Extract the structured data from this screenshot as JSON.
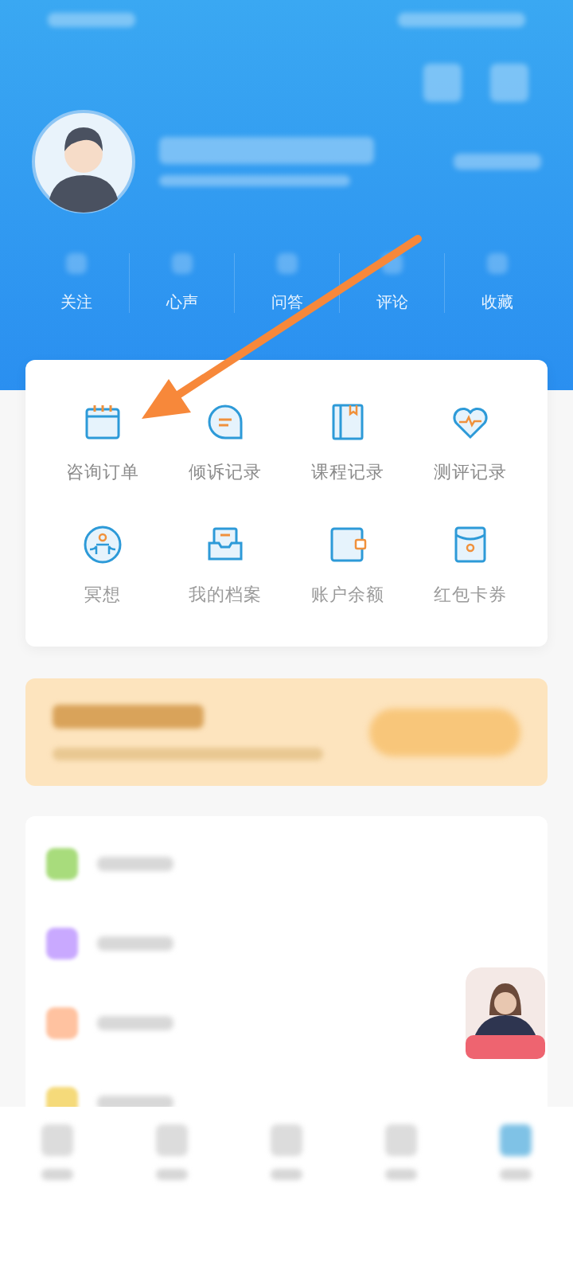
{
  "stats": [
    {
      "label": "关注"
    },
    {
      "label": "心声"
    },
    {
      "label": "问答"
    },
    {
      "label": "评论"
    },
    {
      "label": "收藏"
    }
  ],
  "services": [
    {
      "label": "咨询订单",
      "kind": "calendar"
    },
    {
      "label": "倾诉记录",
      "kind": "bubble"
    },
    {
      "label": "课程记录",
      "kind": "book"
    },
    {
      "label": "测评记录",
      "kind": "heart"
    },
    {
      "label": "冥想",
      "kind": "meditation"
    },
    {
      "label": "我的档案",
      "kind": "tray"
    },
    {
      "label": "账户余额",
      "kind": "wallet"
    },
    {
      "label": "红包卡券",
      "kind": "envelope"
    }
  ],
  "menu": [
    {
      "color": "#a8dc7c"
    },
    {
      "color": "#c9a9ff"
    },
    {
      "color": "#ffc2a0"
    },
    {
      "color": "#f5da7a"
    }
  ]
}
